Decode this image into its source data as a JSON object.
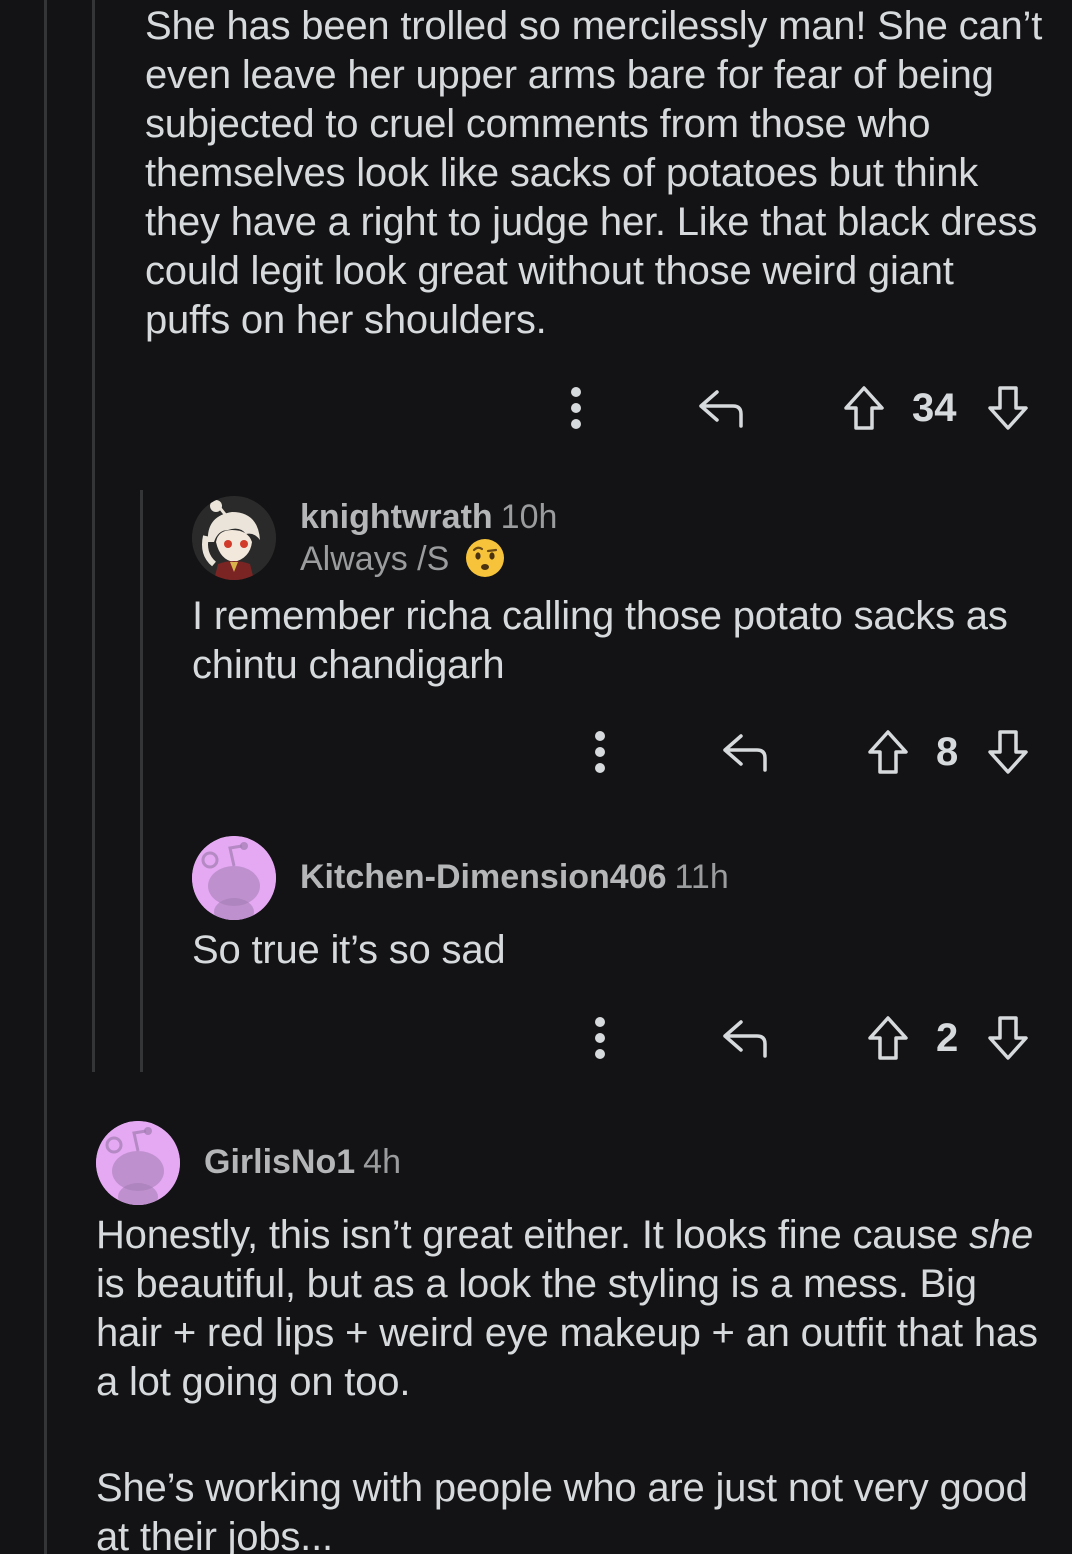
{
  "colors": {
    "background": "#131315",
    "text": "#d7dadc",
    "muted": "#9a9c9e",
    "thread_line": "#343536",
    "avatar_purple": "#e4a9f2"
  },
  "comments": [
    {
      "id": "parent",
      "body": "She has been trolled so mercilessly man! She can’t even leave her upper arms bare for fear of being subjected to cruel comments from those who themselves look like sacks of potatoes but think they have a right to judge her. Like that black dress could legit look great without those weird giant puffs on her shoulders.",
      "score": "34",
      "icons": {
        "more": "more-vertical-icon",
        "reply": "reply-icon",
        "upvote": "upvote-arrow-icon",
        "downvote": "downvote-arrow-icon"
      }
    },
    {
      "id": "reply1",
      "username": "knightwrath",
      "time": "10h",
      "flair": "Always /S",
      "flair_emoji": "raised-eyebrow-emoji",
      "body": "I remember richa calling those potato sacks as chintu chandigarh",
      "score": "8"
    },
    {
      "id": "reply2",
      "username": "Kitchen-Dimension406",
      "time": "11h",
      "body": "So true it’s so sad",
      "score": "2"
    },
    {
      "id": "top2",
      "username": "GirlisNo1",
      "time": "4h",
      "body_p1_em": "she",
      "body_p1_pre": "Honestly, this isn’t great either. It looks fine cause ",
      "body_p1_post": " is beautiful, but as a look the styling is a mess. Big hair + red lips + weird eye makeup + an outfit that has a lot going on too.",
      "body_p2": "She’s working with people who are just not very good at their jobs..."
    }
  ]
}
